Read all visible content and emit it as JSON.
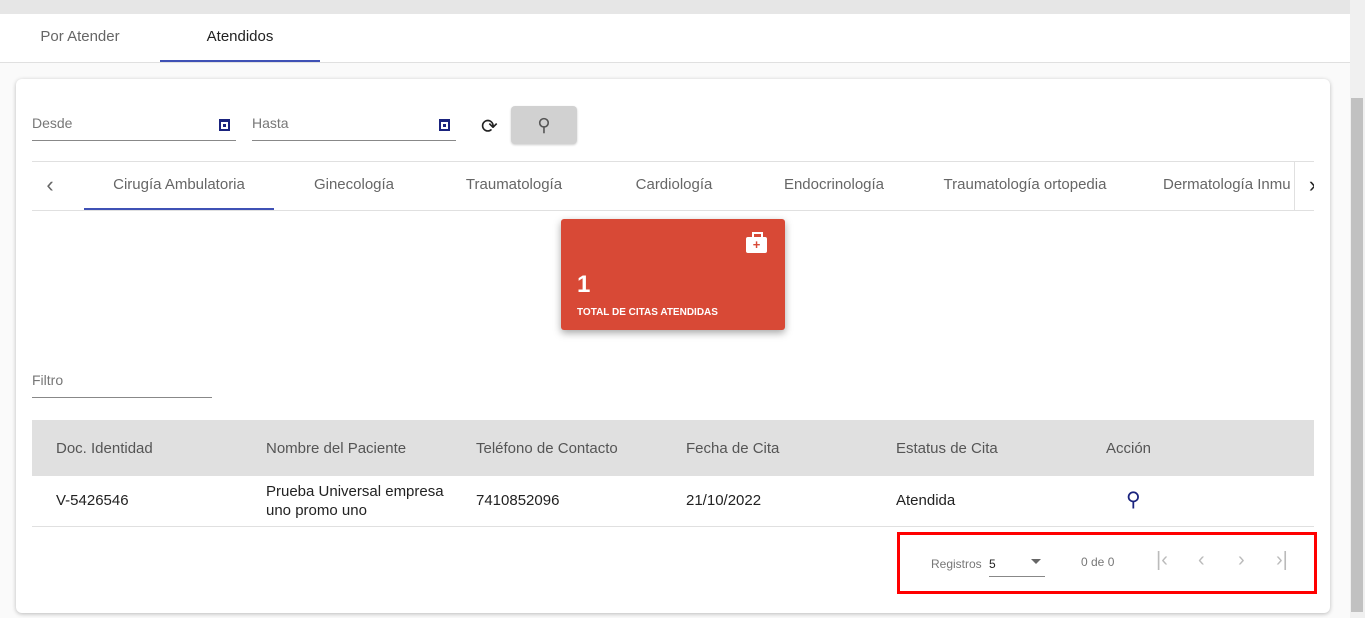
{
  "page_tabs": [
    "Por Atender",
    "Atendidos"
  ],
  "filters": {
    "desde": "Desde",
    "hasta": "Hasta",
    "filtro": "Filtro"
  },
  "specialties": [
    "Cirugía Ambulatoria",
    "Ginecología",
    "Traumatología",
    "Cardiología",
    "Endocrinología",
    "Traumatología ortopedia",
    "Dermatología Inmu"
  ],
  "kpi": {
    "value": "1",
    "label": "TOTAL DE CITAS ATENDIDAS",
    "color": "#d84936"
  },
  "table": {
    "headers": [
      "Doc. Identidad",
      "Nombre del Paciente",
      "Teléfono de Contacto",
      "Fecha de Cita",
      "Estatus de Cita",
      "Acción"
    ],
    "rows": [
      [
        "V-5426546",
        "Prueba Universal empresa uno promo uno",
        "7410852096",
        "21/10/2022",
        "Atendida"
      ]
    ]
  },
  "paginator": {
    "label": "Registros",
    "page_size": "5",
    "range": "0 de 0"
  }
}
